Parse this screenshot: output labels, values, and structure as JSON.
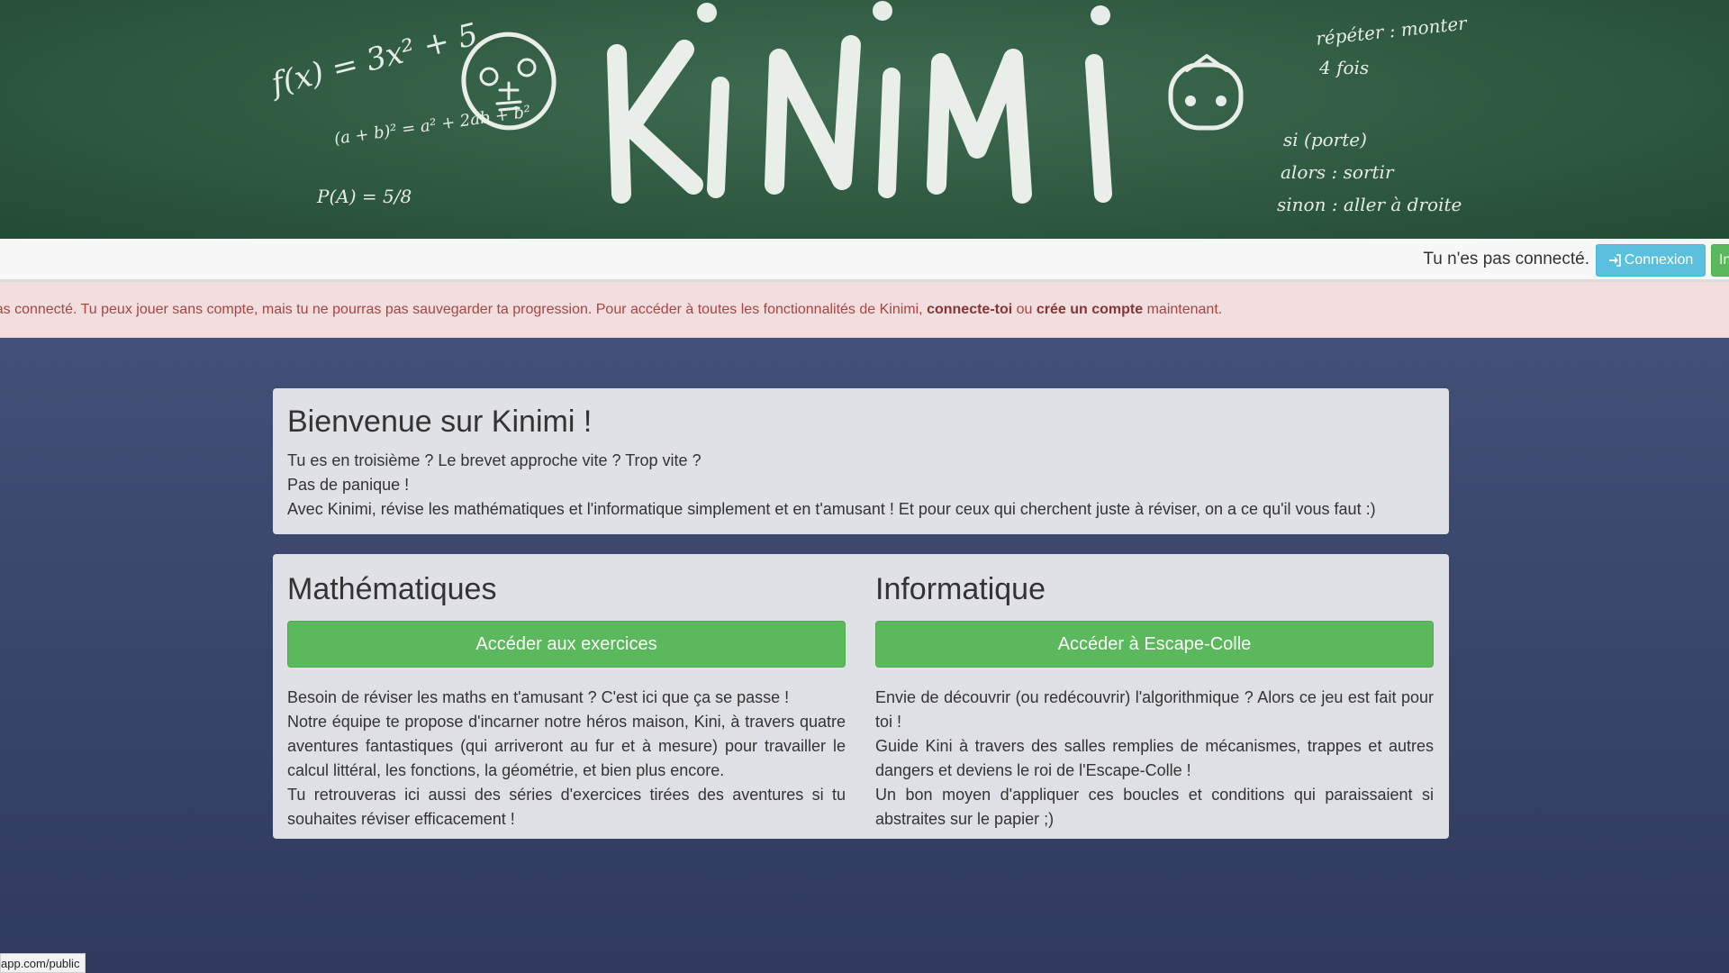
{
  "banner": {
    "logo_text": "KiNiMi",
    "formula1": "f(x) = 3x² + 5",
    "formula2": "(a + b)² = a² + 2ab + b²",
    "formula3": "P(A) = 5/8",
    "algo1": "répéter : monter",
    "algo2": "4 fois",
    "algo3": "si (porte)",
    "algo4": "alors : sortir",
    "algo5": "sinon : aller à droite"
  },
  "topbar": {
    "status": "Tu n'es pas connecté.",
    "login_label": "Connexion",
    "signup_label": "Inscription"
  },
  "alert": {
    "text_before": "Tu n'es pas connecté. Tu peux jouer sans compte, mais tu ne pourras pas sauvegarder ta progression. Pour accéder à toutes les fonctionnalités de Kinimi, ",
    "link_connect": "connecte-toi",
    "text_or": " ou ",
    "link_create": "crée un compte",
    "text_after": " maintenant."
  },
  "welcome": {
    "title": "Bienvenue sur Kinimi !",
    "line1": "Tu es en troisième ? Le brevet approche vite ? Trop vite ?",
    "line2": "Pas de panique !",
    "line3": "Avec Kinimi, révise les mathématiques et l'informatique simplement et en t'amusant ! Et pour ceux qui cherchent juste à réviser, on a ce qu'il vous faut :)"
  },
  "math": {
    "title": "Mathématiques",
    "button": "Accéder aux exercices",
    "p1": "Besoin de réviser les maths en t'amusant ? C'est ici que ça se passe !",
    "p2": "Notre équipe te propose d'incarner notre héros maison, Kini, à travers quatre aventures fantastiques (qui arriveront au fur et à mesure) pour travailler le calcul littéral, les fonctions, la géométrie, et bien plus encore.",
    "p3": "Tu retrouveras ici aussi des séries d'exercices tirées des aventures si tu souhaites réviser efficacement !"
  },
  "info": {
    "title": "Informatique",
    "button": "Accéder à Escape-Colle",
    "p1": "Envie de découvrir (ou redécouvrir) l'algorithmique ? Alors ce jeu est fait pour toi !",
    "p2": "Guide Kini à travers des salles remplies de mécanismes, trappes et autres dangers et deviens le roi de l'Escape-Colle !",
    "p3": "Un bon moyen d'appliquer ces boucles et conditions qui paraissaient si abstraites sur le papier ;)"
  },
  "statusbar": {
    "url": "app.com/public"
  },
  "colors": {
    "success": "#5cb85c",
    "info": "#5bc0de",
    "danger_bg": "#f2dede",
    "danger_text": "#a94442",
    "chalkboard": "#2f5a41"
  }
}
